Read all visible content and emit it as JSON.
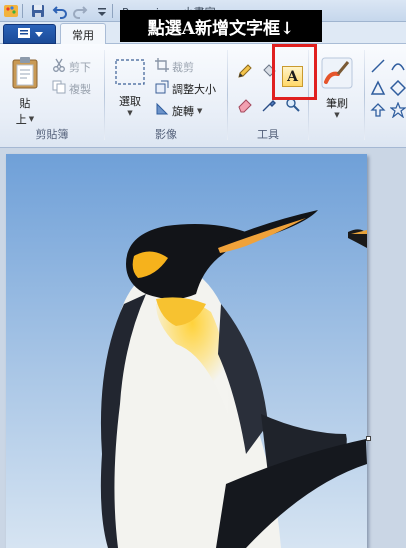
{
  "titlebar": {
    "window_title": "Penguins - 小畫家",
    "icons": [
      "paint-app-icon",
      "save-icon",
      "undo-icon",
      "redo-icon",
      "customize-quick-access-icon"
    ]
  },
  "annotation": {
    "banner_text": "點選A新增文字框↓"
  },
  "tabs": {
    "file_menu_icon": "file-menu-icon",
    "home_label": "常用"
  },
  "ribbon": {
    "clipboard": {
      "label": "剪貼簿",
      "paste_top": "貼",
      "paste_bottom": "上",
      "cut": "剪下",
      "copy": "複製"
    },
    "image": {
      "label": "影像",
      "select": "選取",
      "crop": "裁剪",
      "resize": "調整大小",
      "rotate": "旋轉"
    },
    "tools": {
      "label": "工具",
      "text_tool_glyph": "A"
    },
    "brushes": {
      "label": "筆刷"
    }
  },
  "colors": {
    "accent_red": "#e02020",
    "file_button": "#2a62b8",
    "workspace": "#cad6e5"
  }
}
